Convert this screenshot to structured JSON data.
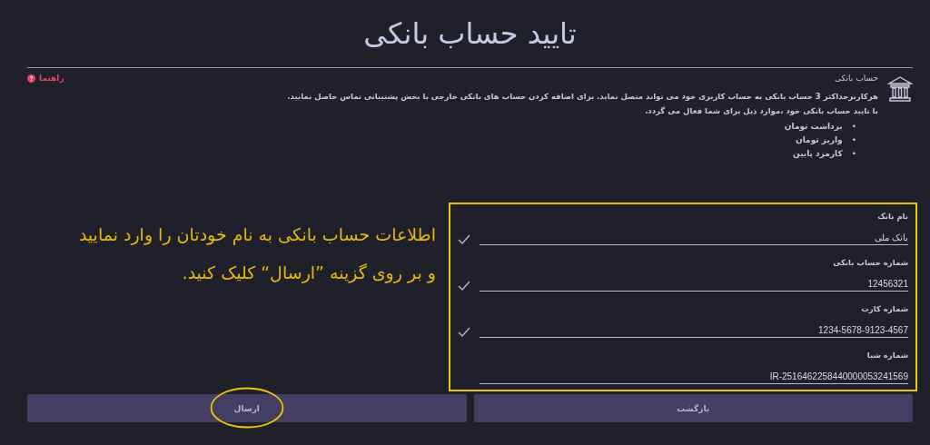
{
  "title": "تایید حساب بانکی",
  "help_link": "راهنما",
  "info": {
    "heading": "حساب بانکی",
    "paragraphs": [
      "هرکاربرحداکثر 3 حساب بانکی به حساب کاربری خود می تواند متصل نماید. برای اضافه کردن حساب های بانکی خارجی با بخش پشتیبانی تماس حاصل نمایید.",
      "با تایید حساب بانکی خود ،موارد ذیل برای شما فعال می گردد."
    ],
    "bullets": [
      {
        "marker": "•",
        "text": "برداشت تومان"
      },
      {
        "marker": "•",
        "text": "واریز تومان"
      },
      {
        "marker": "•",
        "text": "کارمزد پایین"
      }
    ]
  },
  "instruction": [
    "اطلاعات حساب بانکی به نام خودتان را وارد نمایید",
    "و بر روی گزینه ”ارسال“ کلیک کنید."
  ],
  "fields": [
    {
      "label": "نام بانک",
      "value": "بانک ملی",
      "valid": true
    },
    {
      "label": "شماره حساب بانکی",
      "value": "12456321",
      "valid": true
    },
    {
      "label": "شماره کارت",
      "value": "1234-5678-9123-4567",
      "valid": true
    },
    {
      "label": "شماره شبا",
      "value": "IR-2516462258440000053241569",
      "valid": false
    }
  ],
  "buttons": [
    {
      "label": "بازگشت",
      "highlighted": false
    },
    {
      "label": "ارسال",
      "highlighted": true
    }
  ]
}
